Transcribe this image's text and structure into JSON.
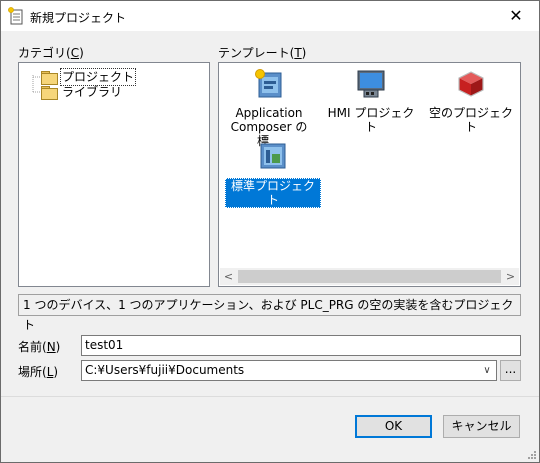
{
  "window": {
    "title": "新規プロジェクト",
    "close_glyph": "✕"
  },
  "categories": {
    "label_prefix": "カテゴリ(",
    "label_key": "C",
    "label_suffix": ")",
    "items": [
      {
        "label": "プロジェクト",
        "selected": true
      },
      {
        "label": "ライブラリ",
        "selected": false
      }
    ]
  },
  "templates": {
    "label_prefix": "テンプレート(",
    "label_key": "T",
    "label_suffix": ")",
    "items": [
      {
        "line1": "Application",
        "line2": "Composer の標…",
        "icon": "application-composer-icon",
        "selected": false
      },
      {
        "line1": "HMI プロジェクト",
        "line2": "",
        "icon": "hmi-project-icon",
        "selected": false
      },
      {
        "line1": "空のプロジェクト",
        "line2": "",
        "icon": "empty-project-icon",
        "selected": false
      },
      {
        "line1": "標準プロジェクト",
        "line2": "",
        "icon": "standard-project-icon",
        "selected": true
      }
    ],
    "scroll_left": "<",
    "scroll_right": ">"
  },
  "description": "1 つのデバイス、1 つのアプリケーション、および PLC_PRG の空の実装を含むプロジェクト",
  "name_field": {
    "label_prefix": "名前(",
    "label_key": "N",
    "label_suffix": ")",
    "value": "test01"
  },
  "location_field": {
    "label_prefix": "場所(",
    "label_key": "L",
    "label_suffix": ")",
    "value": "C:¥Users¥fujii¥Documents",
    "browse_label": "..."
  },
  "buttons": {
    "ok": "OK",
    "cancel": "キャンセル"
  },
  "colors": {
    "selection": "#0078d7",
    "dialog_bg": "#f0f0f0"
  }
}
